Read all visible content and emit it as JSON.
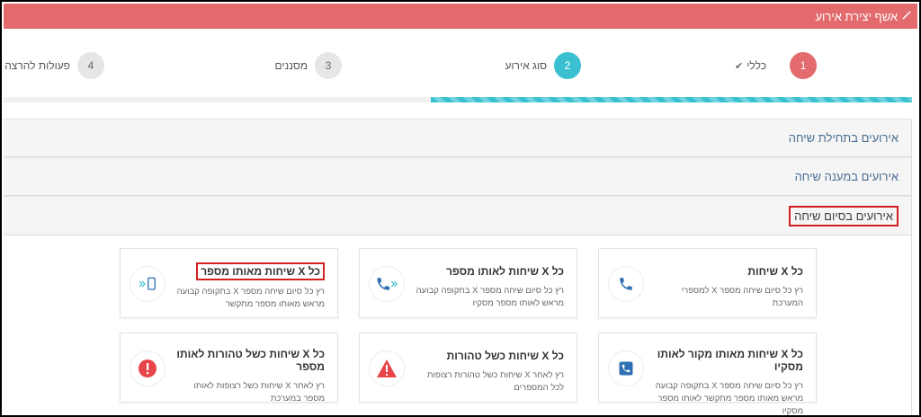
{
  "header": {
    "title": "אשף יצירת אירוע"
  },
  "steps": [
    {
      "number": "1",
      "label": "כללי",
      "state": "done"
    },
    {
      "number": "2",
      "label": "סוג אירוע",
      "state": "active"
    },
    {
      "number": "3",
      "label": "מסננים",
      "state": "todo"
    },
    {
      "number": "4",
      "label": "פעולות להרצה",
      "state": "todo"
    }
  ],
  "progress": {
    "percent": 53
  },
  "accordion": {
    "start": "אירועים בתחילת שיחה",
    "answer": "אירועים במענה שיחה",
    "end": "אירועים בסיום שיחה"
  },
  "cards": {
    "all_calls": {
      "title": "כל X שיחות",
      "desc": "רץ כל סיום שיחה מספר X למספרי המערכת"
    },
    "to_same_number": {
      "title": "כל X שיחות לאותו מספר",
      "desc": "רץ כל סיום שיחה מספר X בתקופה קבועה מראש לאותו מספר מסקיו"
    },
    "from_same_number": {
      "title": "כל X שיחות מאותו מספר",
      "desc": "רץ כל סיום שיחה מספר X בתקופה קבועה מראש מאותו מספר מתקשר"
    },
    "same_source_to_same": {
      "title": "כל X שיחות מאותו מקור לאותו מסקיו",
      "desc": "רץ כל סיום שיחה מספר X בתקופה קבועה מראש מאותו מספר מתקשר לאותו מספר מסקיו"
    },
    "failed_routes": {
      "title": "כל X שיחות כשל טהורות",
      "desc": "רץ לאחר X שיחות כשל טהורות רצופות לכל המספרים"
    },
    "failed_routes_same": {
      "title": "כל X שיחות כשל טהורות לאותו מספר",
      "desc": "רץ לאחר X שיחות כשל רצופות לאותו מספר במערכת"
    }
  },
  "colors": {
    "header": "#e36a6d",
    "active_step": "#3ac0d0",
    "phone_icon": "#2f6fb3",
    "alert": "#e8454a"
  }
}
